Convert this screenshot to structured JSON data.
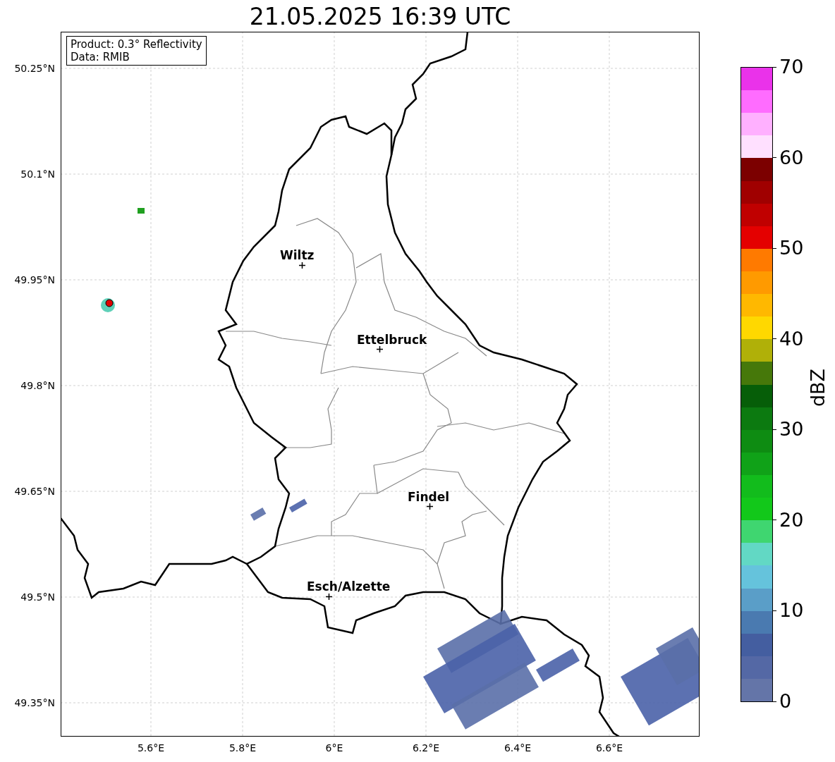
{
  "title": "21.05.2025 16:39 UTC",
  "map": {
    "info_box": [
      "Product: 0.3° Reflectivity",
      "Data: RMIB"
    ],
    "cities": [
      {
        "name": "Wiltz"
      },
      {
        "name": "Ettelbruck"
      },
      {
        "name": "Findel"
      },
      {
        "name": "Esch/Alzette"
      }
    ],
    "lat_ticks": [
      "50.25°N",
      "50.1°N",
      "49.95°N",
      "49.8°N",
      "49.65°N",
      "49.5°N",
      "49.35°N"
    ],
    "lon_ticks": [
      "5.6°E",
      "5.8°E",
      "6°E",
      "6.2°E",
      "6.4°E",
      "6.6°E"
    ]
  },
  "colorbar": {
    "label": "dBZ",
    "ticks": [
      "70",
      "60",
      "50",
      "40",
      "30",
      "20",
      "10",
      "0"
    ],
    "bands": [
      {
        "color": "#ea32ea"
      },
      {
        "color": "#ff6cff"
      },
      {
        "color": "#ffb0ff"
      },
      {
        "color": "#ffe0ff"
      },
      {
        "color": "#7c0000"
      },
      {
        "color": "#a00000"
      },
      {
        "color": "#c00000"
      },
      {
        "color": "#e40000"
      },
      {
        "color": "#ff7a00"
      },
      {
        "color": "#ff9a00"
      },
      {
        "color": "#ffb800"
      },
      {
        "color": "#ffd800"
      },
      {
        "color": "#b0b008"
      },
      {
        "color": "#46780a"
      },
      {
        "color": "#065e08"
      },
      {
        "color": "#0c7a10"
      },
      {
        "color": "#0e8c12"
      },
      {
        "color": "#10a218"
      },
      {
        "color": "#12bc1c"
      },
      {
        "color": "#12c81a"
      },
      {
        "color": "#3fd670"
      },
      {
        "color": "#62d8c4"
      },
      {
        "color": "#65c3dc"
      },
      {
        "color": "#5a9ec8"
      },
      {
        "color": "#4a7ab0"
      },
      {
        "color": "#445ea0"
      },
      {
        "color": "#5468a5"
      },
      {
        "color": "#6475a8"
      }
    ]
  }
}
